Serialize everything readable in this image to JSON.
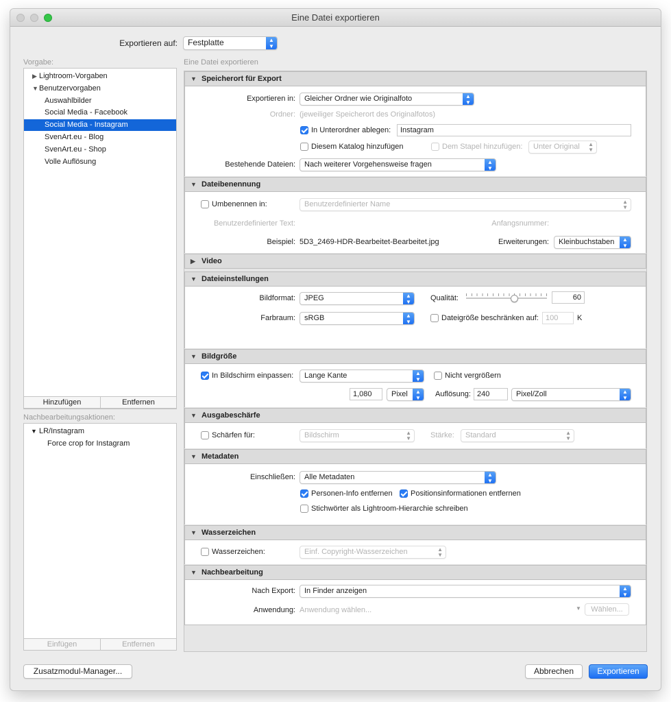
{
  "window": {
    "title": "Eine Datei exportieren"
  },
  "top": {
    "export_to_label": "Exportieren auf:",
    "export_to_value": "Festplatte"
  },
  "left": {
    "presets_label": "Vorgabe:",
    "tree": [
      {
        "label": "Lightroom-Vorgaben",
        "indent": 0,
        "arrow": "▶"
      },
      {
        "label": "Benutzervorgaben",
        "indent": 0,
        "arrow": "▼"
      },
      {
        "label": "Auswahlbilder",
        "indent": 1
      },
      {
        "label": "Social Media - Facebook",
        "indent": 1
      },
      {
        "label": "Social Media - Instagram",
        "indent": 1,
        "selected": true
      },
      {
        "label": "SvenArt.eu - Blog",
        "indent": 1
      },
      {
        "label": "SvenArt.eu - Shop",
        "indent": 1
      },
      {
        "label": "Volle Auflösung",
        "indent": 1
      }
    ],
    "add_label": "Hinzufügen",
    "remove_label": "Entfernen",
    "post_label": "Nachbearbeitungsaktionen:",
    "post_tree": [
      {
        "label": "LR/Instagram",
        "arrow": "▼"
      },
      {
        "label": "Force crop for Instagram"
      }
    ],
    "insert_label": "Einfügen",
    "post_remove_label": "Entfernen"
  },
  "main": {
    "header": "Eine Datei exportieren",
    "location": {
      "title": "Speicherort für Export",
      "export_in_label": "Exportieren in:",
      "export_in_value": "Gleicher Ordner wie Originalfoto",
      "folder_label": "Ordner:",
      "folder_value": "(jeweiliger Speicherort des Originalfotos)",
      "subfolder_label": "In Unterordner ablegen:",
      "subfolder_value": "Instagram",
      "catalog_label": "Diesem Katalog hinzufügen",
      "stack_label": "Dem Stapel hinzufügen:",
      "stack_value": "Unter Original",
      "existing_label": "Bestehende Dateien:",
      "existing_value": "Nach weiterer Vorgehensweise fragen"
    },
    "naming": {
      "title": "Dateibenennung",
      "rename_label": "Umbenennen in:",
      "rename_value": "Benutzerdefinierter Name",
      "custom_text_label": "Benutzerdefinierter Text:",
      "start_number_label": "Anfangsnummer:",
      "example_label": "Beispiel:",
      "example_value": "5D3_2469-HDR-Bearbeitet-Bearbeitet.jpg",
      "extensions_label": "Erweiterungen:",
      "extensions_value": "Kleinbuchstaben"
    },
    "video": {
      "title": "Video"
    },
    "file_settings": {
      "title": "Dateieinstellungen",
      "format_label": "Bildformat:",
      "format_value": "JPEG",
      "quality_label": "Qualität:",
      "quality_value": "60",
      "quality_fraction": 0.6,
      "colorspace_label": "Farbraum:",
      "colorspace_value": "sRGB",
      "limit_label": "Dateigröße beschränken auf:",
      "limit_value": "100",
      "limit_unit": "K"
    },
    "image_size": {
      "title": "Bildgröße",
      "fit_label": "In Bildschirm einpassen:",
      "fit_value": "Lange Kante",
      "dont_enlarge_label": "Nicht vergrößern",
      "size_value": "1,080",
      "size_unit": "Pixel",
      "resolution_label": "Auflösung:",
      "resolution_value": "240",
      "resolution_unit": "Pixel/Zoll"
    },
    "sharpening": {
      "title": "Ausgabeschärfe",
      "sharpen_label": "Schärfen für:",
      "sharpen_value": "Bildschirm",
      "amount_label": "Stärke:",
      "amount_value": "Standard"
    },
    "metadata": {
      "title": "Metadaten",
      "include_label": "Einschließen:",
      "include_value": "Alle Metadaten",
      "person_label": "Personen-Info entfernen",
      "location_label": "Positionsinformationen entfernen",
      "keywords_label": "Stichwörter als Lightroom-Hierarchie schreiben"
    },
    "watermark": {
      "title": "Wasserzeichen",
      "label": "Wasserzeichen:",
      "value": "Einf. Copyright-Wasserzeichen"
    },
    "post_processing": {
      "title": "Nachbearbeitung",
      "after_label": "Nach Export:",
      "after_value": "In Finder anzeigen",
      "app_label": "Anwendung:",
      "app_placeholder": "Anwendung wählen...",
      "choose_label": "Wählen..."
    }
  },
  "footer": {
    "plugin_manager": "Zusatzmodul-Manager...",
    "cancel": "Abbrechen",
    "export": "Exportieren"
  }
}
